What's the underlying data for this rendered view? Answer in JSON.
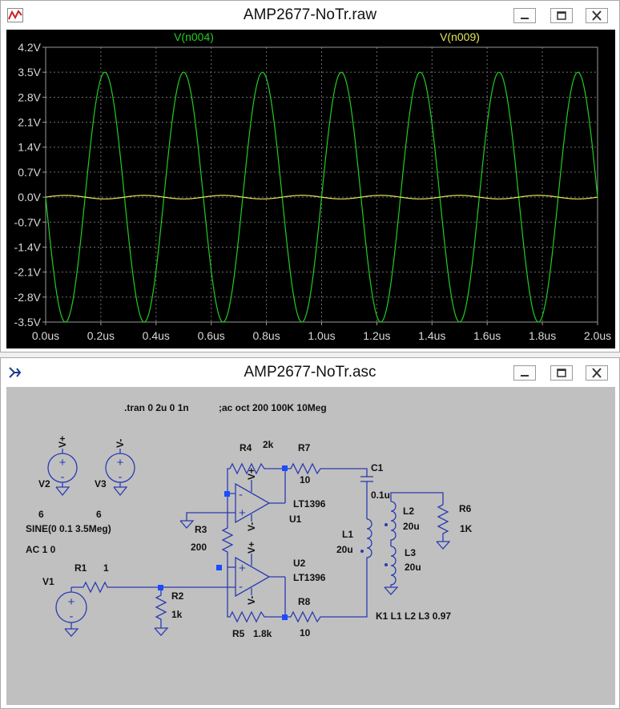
{
  "waveform_window": {
    "title": "AMP2677-NoTr.raw",
    "icon": "waveform-app-icon",
    "buttons": [
      "minimize-icon",
      "maximize-icon",
      "close-icon"
    ]
  },
  "schematic_window": {
    "title": "AMP2677-NoTr.asc",
    "icon": "schematic-app-icon",
    "buttons": [
      "minimize-icon",
      "maximize-icon",
      "close-icon"
    ]
  },
  "colors": {
    "trace1": "#22cc22",
    "trace2": "#e6e65a",
    "wire": "#2a3bb0",
    "node": "#1a4cff"
  },
  "chart_data": {
    "type": "line",
    "series": [
      {
        "name": "V(n004)",
        "color": "#22cc22",
        "amplitude": 3.5,
        "offset": 0.0,
        "frequency_hz": 3500000,
        "phase": "negative-sine"
      },
      {
        "name": "V(n009)",
        "color": "#e6e65a",
        "amplitude": 0.05,
        "offset": 0.0,
        "frequency_hz": 3500000,
        "phase": "positive-sine"
      }
    ],
    "x": {
      "min": 0.0,
      "max": 2.0,
      "unit": "us",
      "ticks": [
        "0.0us",
        "0.2us",
        "0.4us",
        "0.6us",
        "0.8us",
        "1.0us",
        "1.2us",
        "1.4us",
        "1.6us",
        "1.8us",
        "2.0us"
      ]
    },
    "y": {
      "min": -3.5,
      "max": 4.2,
      "unit": "V",
      "ticks": [
        "4.2V",
        "3.5V",
        "2.8V",
        "2.1V",
        "1.4V",
        "0.7V",
        "0.0V",
        "-0.7V",
        "-1.4V",
        "-2.1V",
        "-2.8V",
        "-3.5V"
      ]
    },
    "grid": true
  },
  "schematic": {
    "directives": {
      "tran": ".tran 0 2u 0 1n",
      "ac": ";ac oct 200 100K 10Meg"
    },
    "sources": {
      "v2": {
        "name": "V2",
        "value": "6",
        "net": "V+"
      },
      "v3": {
        "name": "V3",
        "value": "6",
        "net": "V-"
      },
      "v1": {
        "name": "V1",
        "sine": "SINE(0 0.1 3.5Meg)",
        "ac": "AC 1 0"
      }
    },
    "resistors": {
      "r1": {
        "name": "R1",
        "value": "1"
      },
      "r2": {
        "name": "R2",
        "value": "1k"
      },
      "r3": {
        "name": "R3",
        "value": "200"
      },
      "r4": {
        "name": "R4",
        "value": "2k"
      },
      "r5": {
        "name": "R5",
        "value": "1.8k"
      },
      "r6": {
        "name": "R6",
        "value": "1K"
      },
      "r7": {
        "name": "R7",
        "value": "10"
      },
      "r8": {
        "name": "R8",
        "value": "10"
      }
    },
    "opamps": {
      "u1": {
        "name": "U1",
        "model": "LT1396"
      },
      "u2": {
        "name": "U2",
        "model": "LT1396"
      }
    },
    "cap": {
      "name": "C1",
      "value": "0.1u"
    },
    "inductors": {
      "l1": {
        "name": "L1",
        "value": "20u"
      },
      "l2": {
        "name": "L2",
        "value": "20u"
      },
      "l3": {
        "name": "L3",
        "value": "20u"
      }
    },
    "coupling": "K1 L1 L2 L3 0.97",
    "pin_plus": "+",
    "pin_minus": "-",
    "net_vplus": "V+",
    "net_vminus": "V-"
  }
}
